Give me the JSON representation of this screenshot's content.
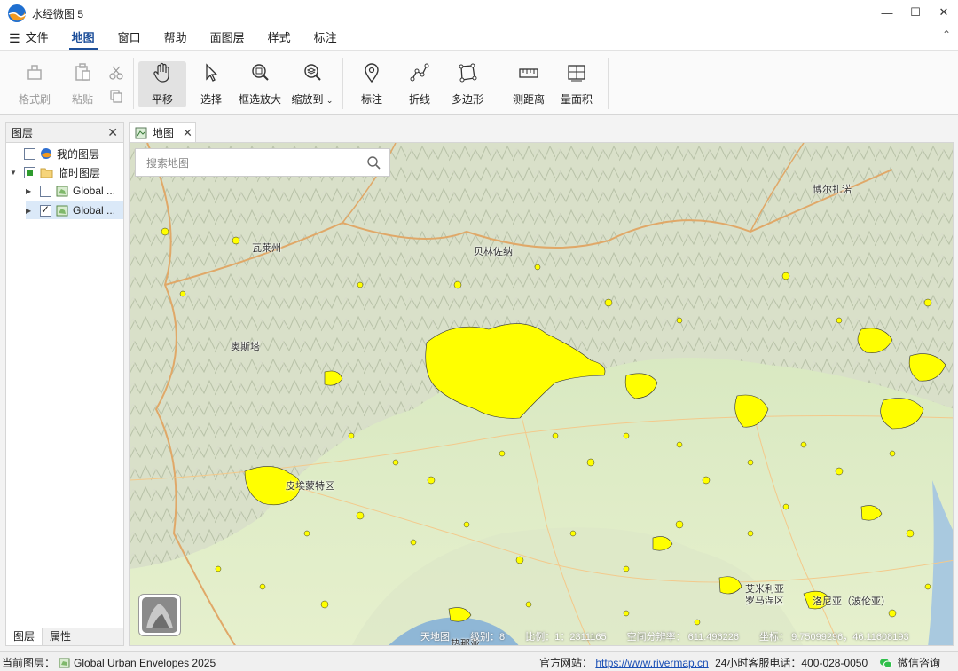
{
  "app": {
    "title": "水经微图 5"
  },
  "menu": {
    "items": [
      "文件",
      "地图",
      "窗口",
      "帮助",
      "面图层",
      "样式",
      "标注"
    ],
    "active_index": 1
  },
  "toolbar": {
    "format_brush": "格式刷",
    "paste": "粘贴",
    "pan": "平移",
    "select": "选择",
    "zoom_box": "框选放大",
    "zoom_to": "缩放到",
    "marker": "标注",
    "polyline": "折线",
    "polygon": "多边形",
    "measure_distance": "测距离",
    "measure_area": "量面积"
  },
  "layers_panel": {
    "title": "图层",
    "items": [
      {
        "label": "我的图层",
        "checked": false
      },
      {
        "label": "临时图层",
        "checked": "partial"
      },
      {
        "label": "Global ...",
        "checked": false
      },
      {
        "label": "Global ...",
        "checked": true
      }
    ],
    "tabs": [
      "图层",
      "属性"
    ]
  },
  "map_tab": {
    "label": "地图"
  },
  "search": {
    "placeholder": "搜索地图"
  },
  "places": [
    "博尔扎诺",
    "瓦莱州",
    "贝林佐纳",
    "奥斯塔",
    "皮埃蒙特区",
    "艾米利亚",
    "罗马涅区",
    "热那亚",
    "洛尼亚（波伦亚）"
  ],
  "map_status": {
    "source": "天地图",
    "level": "级别：8",
    "scale": "比例：1：2311165",
    "resolution": "空间分辨率：  611.496226",
    "coords": "坐标：  9.75099296，46.11608193"
  },
  "statusbar": {
    "current_layer_label": "当前图层：",
    "current_layer": "Global Urban Envelopes 2025",
    "website_label": "官方网站：",
    "website": "https://www.rivermap.cn",
    "hotline": "24小时客服电话：400-028-0050",
    "wechat": "微信咨询"
  },
  "colors": {
    "urban_fill": "#ffff00",
    "accent": "#1d4f9a"
  }
}
